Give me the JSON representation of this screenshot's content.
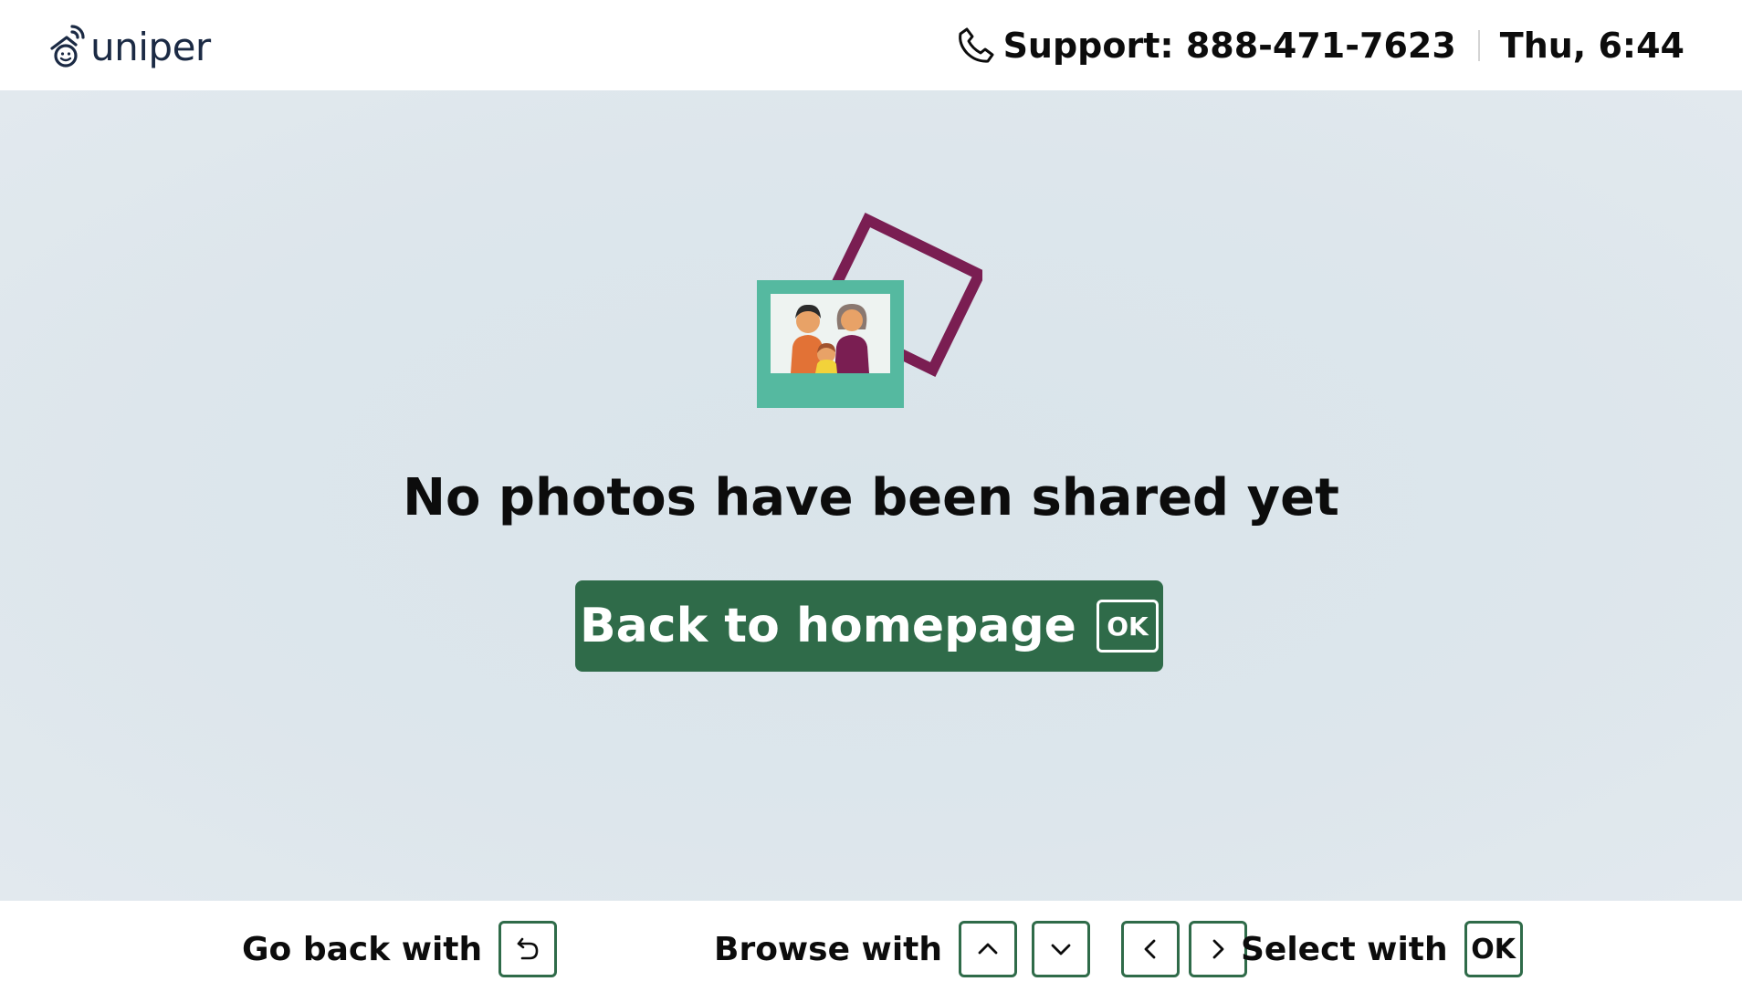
{
  "header": {
    "logo_text": "uniper",
    "logo_icon": "house-wifi-icon",
    "support_icon": "phone-icon",
    "support_text": "Support: 888-471-7623",
    "clock_text": "Thu, 6:44"
  },
  "main": {
    "illustration": "family-photos-illustration",
    "empty_message": "No photos have been shared yet",
    "home_button": {
      "label": "Back to homepage",
      "key_label": "OK"
    }
  },
  "footer": {
    "back": {
      "label": "Go back with",
      "key_icon": "undo-arrow-icon"
    },
    "browse": {
      "label": "Browse with",
      "keys": [
        "chevron-up-icon",
        "chevron-down-icon",
        "chevron-left-icon",
        "chevron-right-icon"
      ]
    },
    "select": {
      "label": "Select with",
      "key_label": "OK"
    }
  },
  "colors": {
    "brand_green": "#2f6b49",
    "background": "#dde6ec",
    "frame_teal": "#55b9a0",
    "frame_maroon": "#7a1e52",
    "logo_navy": "#1b2a44"
  }
}
